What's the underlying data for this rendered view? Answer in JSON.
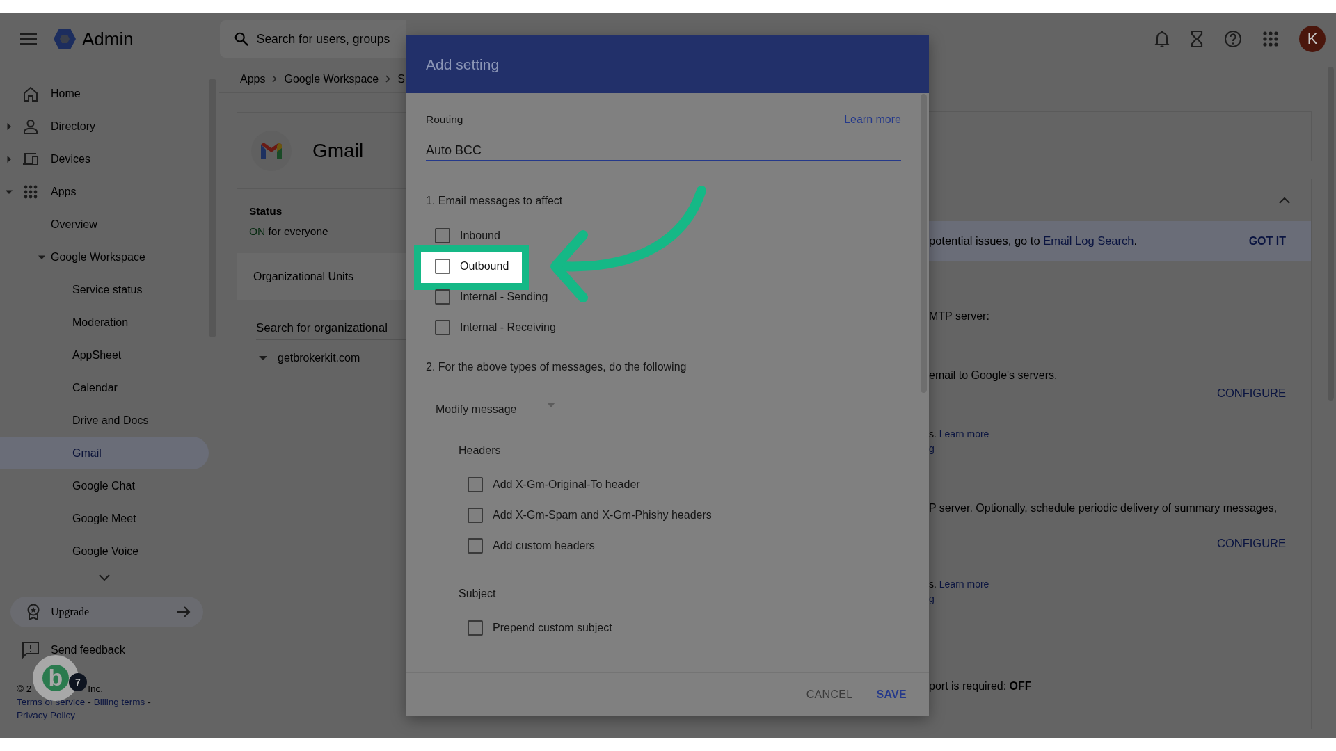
{
  "topbar": {
    "app_name": "Admin",
    "search": {
      "placeholder": "Search for users, groups"
    },
    "avatar_initial": "K"
  },
  "sidebar": {
    "items": [
      {
        "label": "Home",
        "selected": false
      },
      {
        "label": "Directory",
        "expanded": false,
        "selected": false
      },
      {
        "label": "Devices",
        "expanded": false,
        "selected": false
      },
      {
        "label": "Apps",
        "expanded": true,
        "selected": false,
        "children": [
          {
            "label": "Overview",
            "selected": false
          },
          {
            "label": "Google Workspace",
            "expanded": true,
            "selected": false,
            "children": [
              {
                "label": "Service status",
                "selected": false
              },
              {
                "label": "Moderation",
                "selected": false
              },
              {
                "label": "AppSheet",
                "selected": false
              },
              {
                "label": "Calendar",
                "selected": false
              },
              {
                "label": "Drive and Docs",
                "selected": false
              },
              {
                "label": "Gmail",
                "selected": true
              },
              {
                "label": "Google Chat",
                "selected": false
              },
              {
                "label": "Google Meet",
                "selected": false
              },
              {
                "label": "Google Voice",
                "selected": false
              }
            ]
          }
        ]
      }
    ],
    "upgrade": "Upgrade",
    "feedback": "Send feedback",
    "footer": {
      "copyright_start": "© 2",
      "copyright_end": "Inc.",
      "links": [
        "Terms of service",
        "Billing terms",
        "Privacy Policy"
      ],
      "separator": "-"
    }
  },
  "helper_widget": {
    "letter": "b",
    "badge": "7"
  },
  "breadcrumb": [
    "Apps",
    "Google Workspace",
    "S"
  ],
  "app_card": {
    "title": "Gmail",
    "status_label": "Status",
    "status_value": "ON",
    "status_text": "for everyone",
    "org_units_title": "Organizational Units",
    "org_search": {
      "placeholder": "Search for organizational"
    },
    "org_tree": [
      {
        "label": "getbrokerkit.com",
        "expanded": true
      }
    ]
  },
  "right_panel": {
    "banner": {
      "text": "potential issues, go to ",
      "link": "Email Log Search",
      "after": ".",
      "action": "GOT IT"
    },
    "lines": [
      {
        "kind": "text",
        "text": "MTP server:"
      },
      {
        "kind": "text",
        "text": "email to Google's servers."
      },
      {
        "kind": "button",
        "text": "CONFIGURE"
      },
      {
        "kind": "text_link",
        "text": "s. ",
        "link": "Learn more"
      },
      {
        "kind": "link",
        "text": "g"
      },
      {
        "kind": "text",
        "text": "P server. Optionally, schedule periodic delivery of summary messages,"
      },
      {
        "kind": "button",
        "text": "CONFIGURE"
      },
      {
        "kind": "text_link",
        "text": "s. ",
        "link": "Learn more"
      },
      {
        "kind": "link",
        "text": "g"
      },
      {
        "kind": "text",
        "text": "port is required: **OFF**"
      }
    ]
  },
  "dialog": {
    "title": "Add setting",
    "category": "Routing",
    "learn_more": "Learn more",
    "name_field": {
      "value": "Auto BCC"
    },
    "section1": {
      "title": "1. Email messages to affect",
      "options": [
        {
          "label": "Inbound",
          "checked": false,
          "highlighted": false
        },
        {
          "label": "Outbound",
          "checked": false,
          "highlighted": true
        },
        {
          "label": "Internal - Sending",
          "checked": false,
          "highlighted": false
        },
        {
          "label": "Internal - Receiving",
          "checked": false,
          "highlighted": false
        }
      ]
    },
    "section2": {
      "title": "2. For the above types of messages, do the following",
      "action": {
        "value": "Modify message"
      },
      "groups": [
        {
          "title": "Headers",
          "options": [
            {
              "label": "Add X-Gm-Original-To header",
              "checked": false
            },
            {
              "label": "Add X-Gm-Spam and X-Gm-Phishy headers",
              "checked": false
            },
            {
              "label": "Add custom headers",
              "checked": false
            }
          ]
        },
        {
          "title": "Subject",
          "options": [
            {
              "label": "Prepend custom subject",
              "checked": false
            }
          ]
        }
      ]
    },
    "buttons": [
      {
        "label": "CANCEL",
        "kind": "secondary"
      },
      {
        "label": "SAVE",
        "kind": "primary"
      }
    ]
  }
}
